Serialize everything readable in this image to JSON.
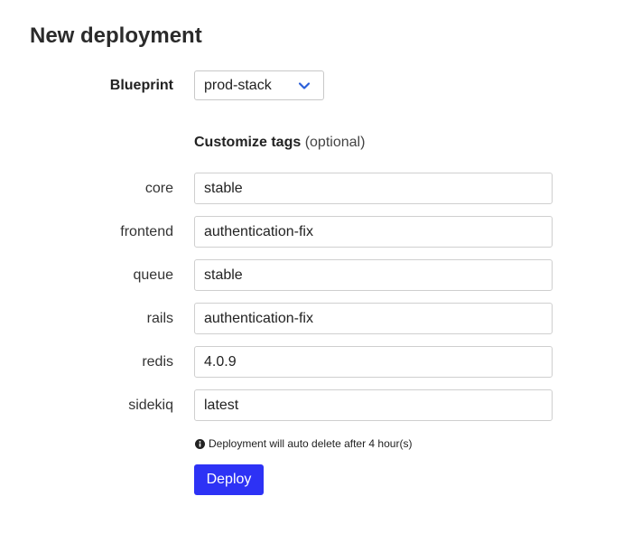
{
  "page": {
    "title": "New deployment"
  },
  "blueprint": {
    "label": "Blueprint",
    "selected": "prod-stack"
  },
  "tags_section": {
    "heading": "Customize tags",
    "optional_note": "(optional)"
  },
  "tags": [
    {
      "label": "core",
      "value": "stable"
    },
    {
      "label": "frontend",
      "value": "authentication-fix"
    },
    {
      "label": "queue",
      "value": "stable"
    },
    {
      "label": "rails",
      "value": "authentication-fix"
    },
    {
      "label": "redis",
      "value": "4.0.9"
    },
    {
      "label": "sidekiq",
      "value": "latest"
    }
  ],
  "notice": {
    "icon": "info-icon",
    "text": "Deployment will auto delete after 4 hour(s)"
  },
  "actions": {
    "deploy_label": "Deploy"
  },
  "colors": {
    "primary_button": "#2d32f5",
    "chevron": "#2b5fd9"
  }
}
